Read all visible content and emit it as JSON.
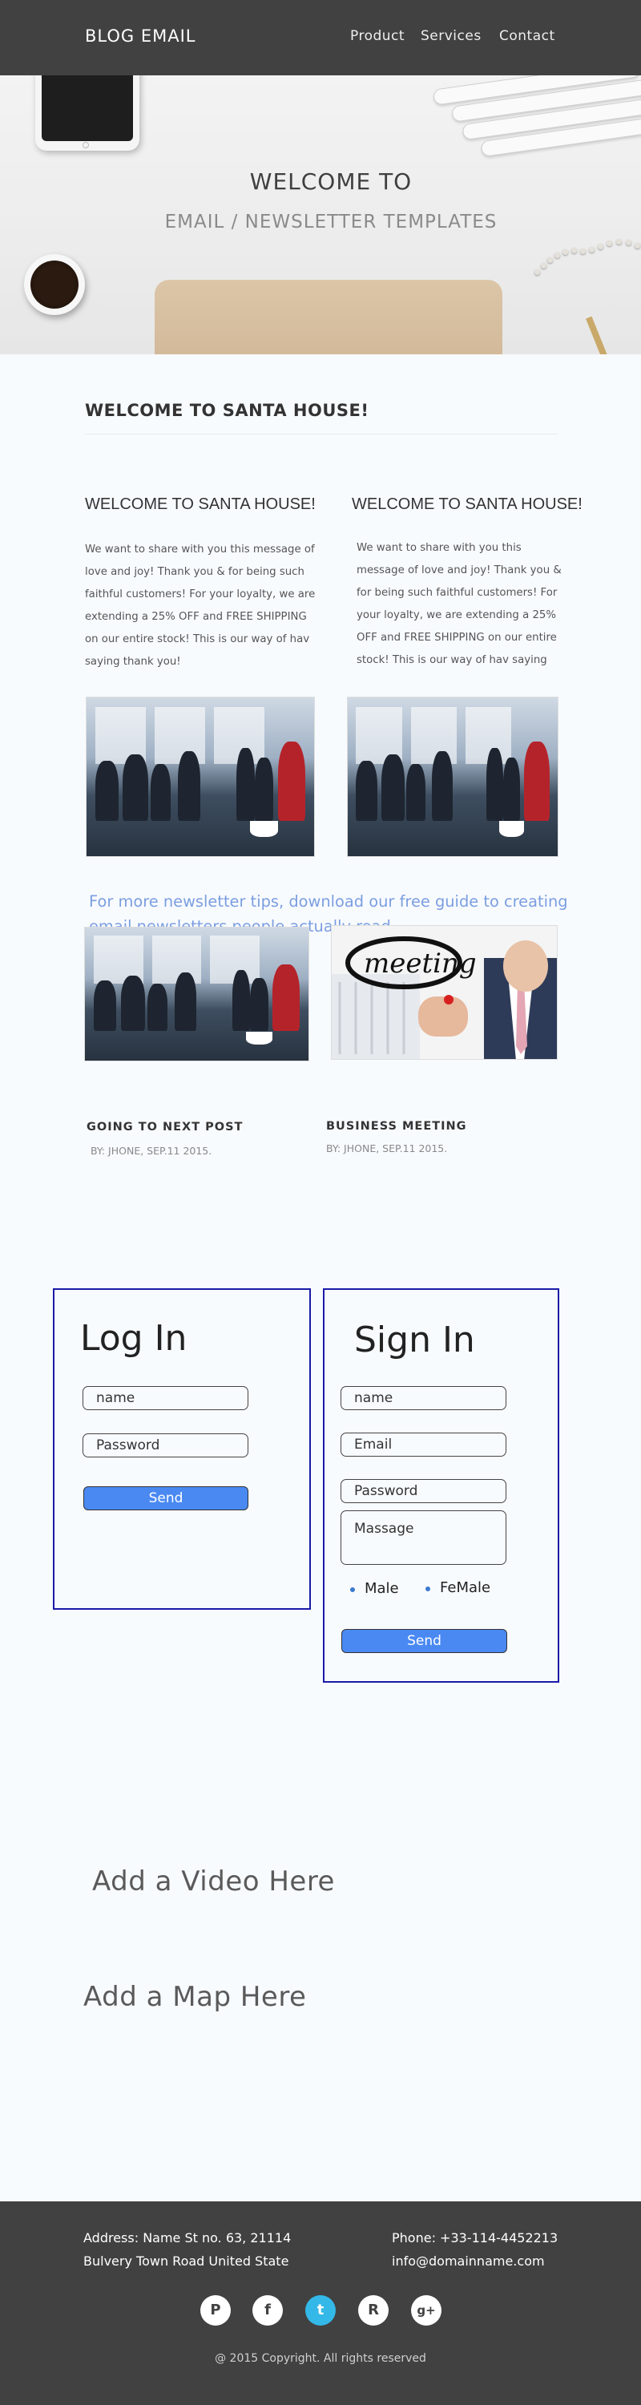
{
  "header": {
    "brand": "BLOG EMAIL",
    "nav": [
      "Product",
      "Services",
      "Contact"
    ]
  },
  "hero": {
    "title": "WELCOME TO",
    "subtitle": "EMAIL / NEWSLETTER TEMPLATES"
  },
  "intro": {
    "heading": "WELCOME TO SANTA HOUSE!",
    "columns": [
      {
        "heading": "WELCOME TO SANTA HOUSE!",
        "lines": [
          "We want to share with you this message of",
          "love and joy! Thank you & for being such",
          "faithful customers! For your loyalty, we are",
          "extending a 25% OFF and FREE SHIPPING",
          "on our entire stock! This is our way of hav",
          "saying thank you!"
        ]
      },
      {
        "heading": "WELCOME TO SANTA HOUSE!",
        "lines": [
          "We want to share with you this",
          "message of love and joy! Thank you &",
          "for being such faithful customers! For",
          "your loyalty, we are extending a 25%",
          "OFF and FREE SHIPPING on our entire",
          "stock! This is our way of hav saying"
        ]
      }
    ]
  },
  "tip": {
    "line1": "For more newsletter tips, download our free guide to creating",
    "line2": "email newsletters people actually read."
  },
  "posts": [
    {
      "title": "GOING TO NEXT POST",
      "meta": "BY: JHONE, SEP.11 2015."
    },
    {
      "title": "BUSINESS MEETING",
      "meta": "BY: JHONE, SEP.11 2015.",
      "image_text": "meeting"
    }
  ],
  "login": {
    "title": "Log In",
    "name_placeholder": "name",
    "password_placeholder": "Password",
    "send_label": "Send"
  },
  "signin": {
    "title": "Sign In",
    "name_placeholder": "name",
    "email_placeholder": "Email",
    "password_placeholder": "Password",
    "message_placeholder": "Massage",
    "options": [
      "Male",
      "FeMale"
    ],
    "send_label": "Send"
  },
  "placeholders": {
    "video": "Add a Video Here",
    "map": "Add a Map Here"
  },
  "footer": {
    "address_line1": "Address: Name St no. 63, 21114",
    "address_line2": "Bulvery Town Road United State",
    "phone": "Phone: +33-114-4452213",
    "email": "info@domainname.com",
    "social": [
      {
        "name": "pinterest-icon",
        "glyph": "P"
      },
      {
        "name": "facebook-icon",
        "glyph": "f"
      },
      {
        "name": "twitter-icon",
        "glyph": "t"
      },
      {
        "name": "rss-icon",
        "glyph": "R"
      },
      {
        "name": "google-plus-icon",
        "glyph": "g+"
      }
    ],
    "copyright": "@ 2015 Copyright. All rights reserved"
  },
  "colors": {
    "header_bg": "#414141",
    "page_bg": "#f8fbfe",
    "tip_text": "#7b9ee0",
    "form_border": "#1a1aa8",
    "send_button": "#4a89f2",
    "twitter": "#33b8e8"
  }
}
